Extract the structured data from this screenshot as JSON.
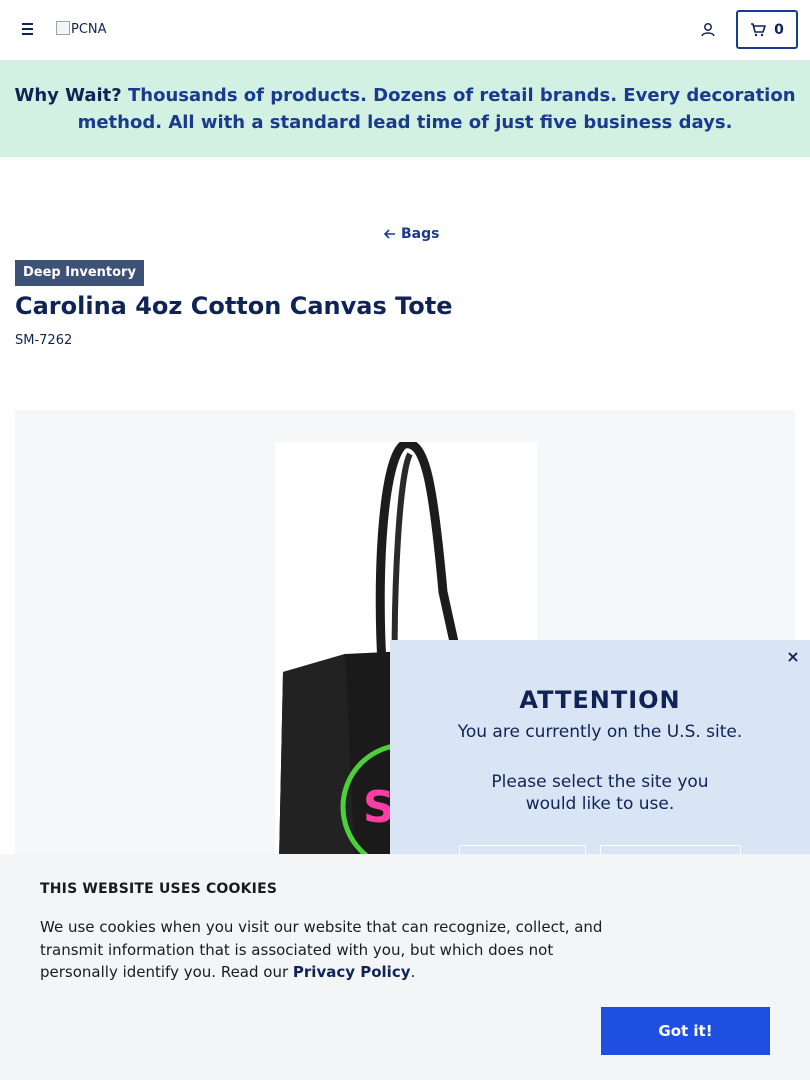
{
  "header": {
    "logo_alt": "PCNA",
    "cart_count": "0"
  },
  "banner": {
    "lead": "Why Wait?",
    "text": " Thousands of products. Dozens of retail brands. Every decoration method. All with a standard lead time of just five business days."
  },
  "product": {
    "back_label": "Bags",
    "badge": "Deep Inventory",
    "title": "Carolina 4oz Cotton Canvas Tote",
    "sku": "SM-7262",
    "image_logo_text": "SC"
  },
  "site_modal": {
    "close_symbol": "×",
    "title": "ATTENTION",
    "line1": "You are currently on the U.S. site.",
    "line2a": "Please select the site you",
    "line2b": "would like to use."
  },
  "cookie_banner": {
    "title": "THIS WEBSITE USES COOKIES",
    "text_before": "We use cookies when you visit our website that can recognize, collect, and transmit information that is associated with you, but which does not personally identify you. Read our ",
    "link_label": "Privacy Policy",
    "text_after": ".",
    "button_label": "Got it!"
  },
  "colors": {
    "navy": "#0f2356",
    "brand_blue": "#1a3a8f",
    "banner_bg": "#d3f1e2",
    "modal_bg": "#d9e4f5",
    "cookie_button": "#1f4fe0",
    "badge_bg": "#3e5277"
  },
  "icons": [
    "menu-icon",
    "account-icon",
    "cart-icon",
    "arrow-left-icon",
    "close-icon"
  ]
}
